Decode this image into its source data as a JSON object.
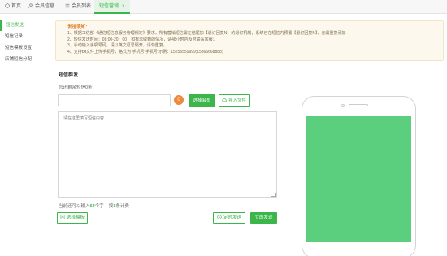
{
  "tabs": [
    {
      "label": "首页",
      "icon": "home-icon"
    },
    {
      "label": "会员信息",
      "icon": "user-icon"
    },
    {
      "label": "会员列表",
      "icon": "list-icon"
    },
    {
      "label": "短信营销",
      "icon": "",
      "close": "×"
    }
  ],
  "sidebar": {
    "items": [
      {
        "label": "短信发送"
      },
      {
        "label": "短信记录"
      },
      {
        "label": "短信模板设置"
      },
      {
        "label": "店铺短信分配"
      }
    ]
  },
  "notice": {
    "title": "发送须知：",
    "lines": [
      "1、根据工信部《通信短信息服务管理规定》要求，所有营销短信需在结尾加【退订回复N】的退订机制，系统已在短信内预置【退订回复N】，无需重复添加",
      "2、短信发送时间：08:00-20：00，如有未收到的情况，请48小时内及时联系客服；",
      "3、手动输入手机号码，请以英文逗号隔开，请勿重复。",
      "4、支持txt文件上传手机号，格式为 手机号;手机号;示例：15255559999;15866668888;"
    ]
  },
  "form": {
    "section_title": "短信群发",
    "remain_label": "您还剩余短信0条",
    "badge": "0",
    "select_member_label": "选择会员",
    "import_file_label": "导入文件",
    "content_placeholder": "请在这里填写短信内容...",
    "counter_prefix": "当前还可以输入",
    "counter_value": "63",
    "counter_mid": "个字",
    "counter_rule_prefix": "按",
    "counter_rule_value": "1",
    "counter_rule_suffix": "条计费",
    "select_template_label": "选择模板",
    "timed_send_label": "定时发送",
    "send_now_label": "立即发送"
  },
  "colors": {
    "accent": "#3cb64a",
    "badge": "#f0883c",
    "notice_title": "#e07a2b",
    "preview_screen": "#5ccf7f"
  }
}
